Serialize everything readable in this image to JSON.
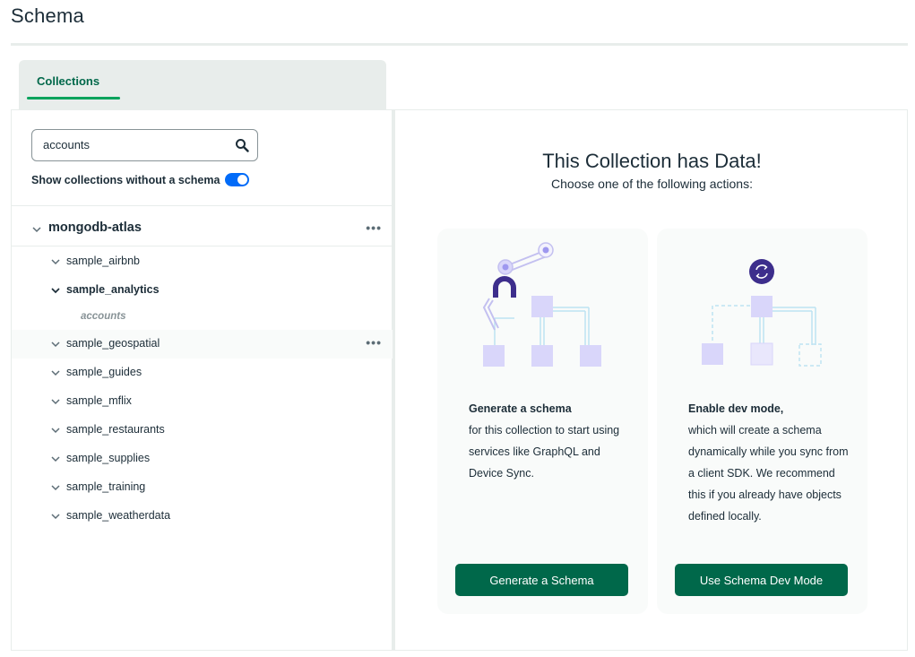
{
  "page": {
    "title": "Schema"
  },
  "tabs": [
    {
      "label": "Collections",
      "active": true
    }
  ],
  "sidebar": {
    "search": {
      "value": "accounts",
      "placeholder": ""
    },
    "toggle": {
      "label": "Show collections without a schema",
      "on": true
    },
    "database": {
      "name": "mongodb-atlas"
    },
    "collections": [
      {
        "name": "sample_airbnb"
      },
      {
        "name": "sample_analytics",
        "expanded": true,
        "children": [
          "accounts"
        ]
      },
      {
        "name": "sample_geospatial"
      },
      {
        "name": "sample_guides"
      },
      {
        "name": "sample_mflix"
      },
      {
        "name": "sample_restaurants"
      },
      {
        "name": "sample_supplies"
      },
      {
        "name": "sample_training"
      },
      {
        "name": "sample_weatherdata"
      }
    ]
  },
  "main": {
    "heading": "This Collection has Data!",
    "subheading": "Choose one of the following actions:",
    "cards": [
      {
        "title": "Generate a schema",
        "body": "for this collection to start using services like GraphQL and Device Sync.",
        "button": "Generate a Schema"
      },
      {
        "title": "Enable dev mode,",
        "body": "which will create a schema dynamically while you sync from a client SDK. We recommend this if you already have objects defined locally.",
        "button": "Use Schema Dev Mode"
      }
    ]
  },
  "colors": {
    "accent": "#00684a",
    "tab_underline": "#00a35c",
    "toggle": "#016bf8",
    "illustration_purple": "#3d2e8c",
    "illustration_lavender": "#d9d6fa"
  }
}
